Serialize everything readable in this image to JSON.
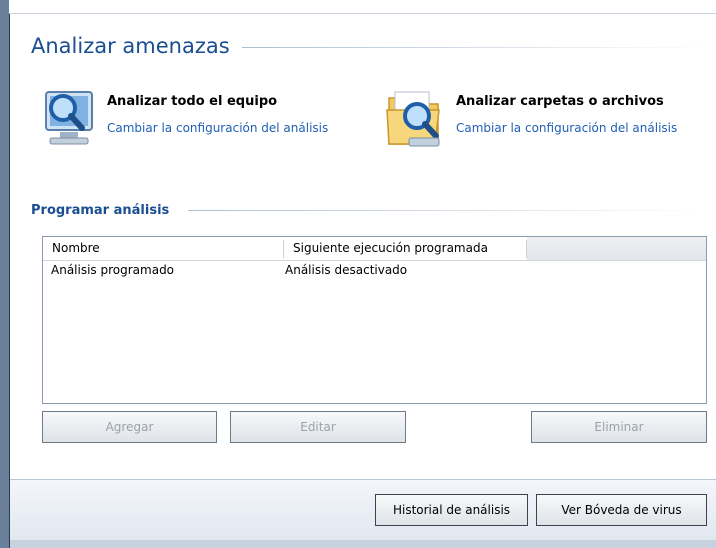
{
  "header": {
    "title": "Analizar amenazas"
  },
  "scan_options": [
    {
      "title": "Analizar todo el equipo",
      "link": "Cambiar la configuración del análisis",
      "icon": "computer-magnifier-icon"
    },
    {
      "title": "Analizar carpetas o archivos",
      "link": "Cambiar la configuración del análisis",
      "icon": "folder-magnifier-icon"
    }
  ],
  "schedule": {
    "title": "Programar análisis",
    "columns": [
      "Nombre",
      "Siguiente ejecución programada"
    ],
    "rows": [
      [
        "Análisis programado",
        "Análisis desactivado"
      ]
    ],
    "buttons": {
      "add": "Agregar",
      "edit": "Editar",
      "delete": "Eliminar"
    }
  },
  "footer": {
    "history": "Historial de análisis",
    "vault": "Ver Bóveda de virus"
  },
  "colors": {
    "title": "#1a4e92",
    "link": "#1f5fb4"
  }
}
